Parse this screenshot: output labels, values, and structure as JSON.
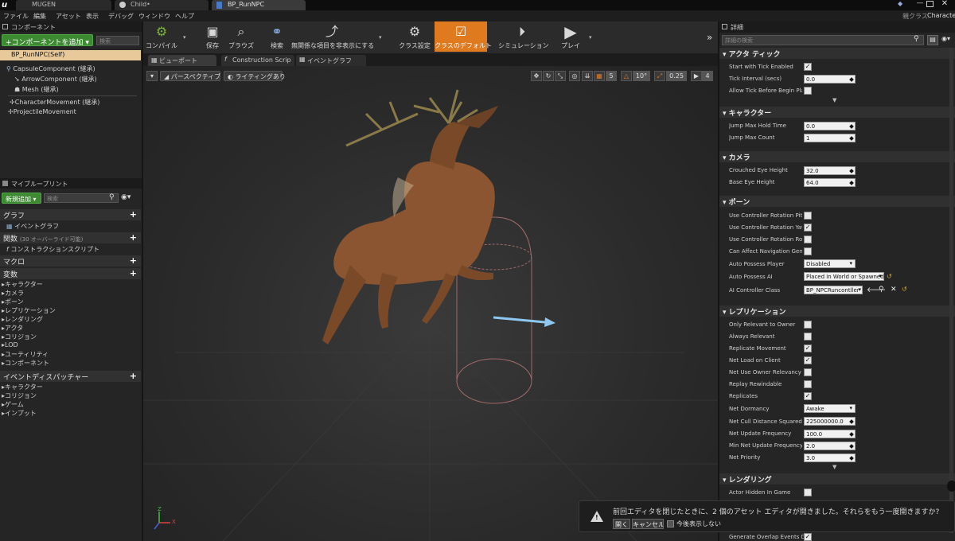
{
  "titlebar": {
    "tabs": [
      "MUGEN",
      "Child•",
      "BP_RunNPC"
    ],
    "right_label": "Character",
    "parent_label": "親クラス"
  },
  "menu": [
    "ファイル",
    "編集",
    "アセット",
    "表示",
    "デバッグ",
    "ウィンドウ",
    "ヘルプ"
  ],
  "components": {
    "header": "コンポーネント",
    "add_button": "+コンポーネントを追加 ▾",
    "search_placeholder": "検索",
    "self_item": "BP_RunNPC(Self)",
    "items": [
      "CapsuleComponent (継承)",
      "ArrowComponent (継承)",
      "Mesh (継承)",
      "CharacterMovement (継承)",
      "ProjectileMovement"
    ]
  },
  "myblueprint": {
    "header": "マイブループリント",
    "new_button": "新規追加 ▾",
    "search_placeholder": "検索",
    "sec_graph": "グラフ",
    "event_graph": "イベントグラフ",
    "sec_functions": "関数",
    "functions_note": "(30 オーバーライド可能)",
    "construction": "コンストラクションスクリプト",
    "sec_macro": "マクロ",
    "sec_vars": "変数",
    "var_items": [
      "キャラクター",
      "カメラ",
      "ポーン",
      "レプリケーション",
      "レンダリング",
      "アクタ",
      "コリジョン",
      "LOD",
      "ユーティリティ",
      "コンポーネント"
    ],
    "sec_dispatchers": "イベントディスパッチャー",
    "dispatcher_items": [
      "キャラクター",
      "コリジョン",
      "ゲーム",
      "インプット"
    ]
  },
  "toolbar": {
    "buttons": [
      {
        "label": "コンパイル",
        "icon": "compile-icon"
      },
      {
        "label": "保存",
        "icon": "save-icon"
      },
      {
        "label": "ブラウズ",
        "icon": "browse-icon"
      },
      {
        "label": "検索",
        "icon": "find-icon"
      },
      {
        "label": "無関係な項目を非表示にする",
        "icon": "hide-unrelated-icon"
      },
      {
        "label": "クラス設定",
        "icon": "class-settings-icon"
      },
      {
        "label": "クラスのデフォルト",
        "icon": "class-defaults-icon"
      },
      {
        "label": "シミュレーション",
        "icon": "simulation-icon"
      },
      {
        "label": "プレイ",
        "icon": "play-icon"
      }
    ]
  },
  "viewport": {
    "tabs": [
      "ビューポート",
      "Construction Scrip",
      "イベントグラフ"
    ],
    "perspective": "パースペクティブ",
    "lighting": "ライティングあり",
    "grid_snap": "5",
    "rot_snap": "10°",
    "scale_snap": "0.25",
    "cam_speed": "4"
  },
  "details": {
    "header": "詳細",
    "search_placeholder": "詳細の検索",
    "sections": {
      "actor_tick": "アクタ ティック",
      "character": "キャラクター",
      "camera": "カメラ",
      "pawn": "ポーン",
      "replication": "レプリケーション",
      "rendering": "レンダリング"
    },
    "start_with_tick": {
      "label": "Start with Tick Enabled",
      "checked": true
    },
    "tick_interval": {
      "label": "Tick Interval (secs)",
      "value": "0.0"
    },
    "allow_tick": {
      "label": "Allow Tick Before Begin Play",
      "checked": false
    },
    "jump_hold": {
      "label": "Jump Max Hold Time",
      "value": "0.0"
    },
    "jump_count": {
      "label": "Jump Max Count",
      "value": "1"
    },
    "crouched_eye": {
      "label": "Crouched Eye Height",
      "value": "32.0"
    },
    "base_eye": {
      "label": "Base Eye Height",
      "value": "64.0"
    },
    "ucr_pitch": {
      "label": "Use Controller Rotation Pitch",
      "checked": false
    },
    "ucr_yaw": {
      "label": "Use Controller Rotation Yaw",
      "checked": true
    },
    "ucr_roll": {
      "label": "Use Controller Rotation Roll",
      "checked": false
    },
    "can_affect_nav": {
      "label": "Can Affect Navigation Generat",
      "checked": false
    },
    "auto_possess_player": {
      "label": "Auto Possess Player",
      "value": "Disabled"
    },
    "auto_possess_ai": {
      "label": "Auto Possess AI",
      "value": "Placed in World or Spawned"
    },
    "ai_controller": {
      "label": "AI Controller Class",
      "value": "BP_NPCRuncontller"
    },
    "only_relevant_owner": {
      "label": "Only Relevant to Owner",
      "checked": false
    },
    "always_relevant": {
      "label": "Always Relevant",
      "checked": false
    },
    "replicate_movement": {
      "label": "Replicate Movement",
      "checked": true
    },
    "net_load_client": {
      "label": "Net Load on Client",
      "checked": true
    },
    "net_use_owner": {
      "label": "Net Use Owner Relevancy",
      "checked": false
    },
    "replay_rewindable": {
      "label": "Replay Rewindable",
      "checked": false
    },
    "replicates": {
      "label": "Replicates",
      "checked": true
    },
    "net_dormancy": {
      "label": "Net Dormancy",
      "value": "Awake"
    },
    "net_cull": {
      "label": "Net Cull Distance Squared",
      "value": "225000000.0"
    },
    "net_update_freq": {
      "label": "Net Update Frequency",
      "value": "100.0"
    },
    "min_net_update": {
      "label": "Min Net Update Frequency",
      "value": "2.0"
    },
    "net_priority": {
      "label": "Net Priority",
      "value": "3.0"
    },
    "actor_hidden": {
      "label": "Actor Hidden In Game",
      "checked": false
    },
    "overflow_label": "Generate Overlap Events Du"
  },
  "notification": {
    "message": "前回エディタを閉じたときに、2 個のアセット エディタが開きました。それらをもう一度開きますか?",
    "open": "開く",
    "cancel": "キャンセル",
    "dont_show": "今後表示しない"
  },
  "colors": {
    "accent_orange": "#e07a1f",
    "add_green": "#3e8a33",
    "panel": "#252525"
  }
}
